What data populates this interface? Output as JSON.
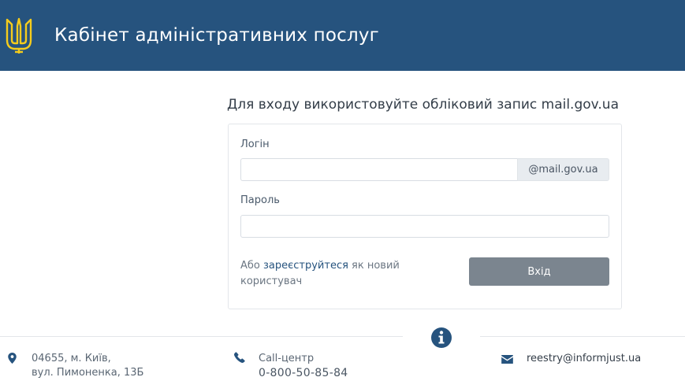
{
  "header": {
    "title": "Кабінет адміністративних послуг",
    "logo_icon": "trident-icon",
    "background": "#26537e",
    "logo_color": "#f5cc1c"
  },
  "login": {
    "heading": "Для входу використовуйте обліковий запис mail.gov.ua",
    "login_label": "Логін",
    "login_value": "",
    "login_suffix": "@mail.gov.ua",
    "password_label": "Пароль",
    "password_value": "",
    "register_prefix": "Або ",
    "register_link": "зареєструйтеся",
    "register_suffix": " як новий користувач",
    "submit_label": "Вхід"
  },
  "footer": {
    "info_icon": "info-circle-icon",
    "address_icon": "map-marker-icon",
    "address_line1": "04655, м. Київ,",
    "address_line2": "вул. Пимоненка, 13Б",
    "phone_icon": "phone-icon",
    "call_label": "Call-центр",
    "call_number": "0-800-50-85-84",
    "email_icon": "envelope-icon",
    "email": "reestry@informjust.ua"
  }
}
